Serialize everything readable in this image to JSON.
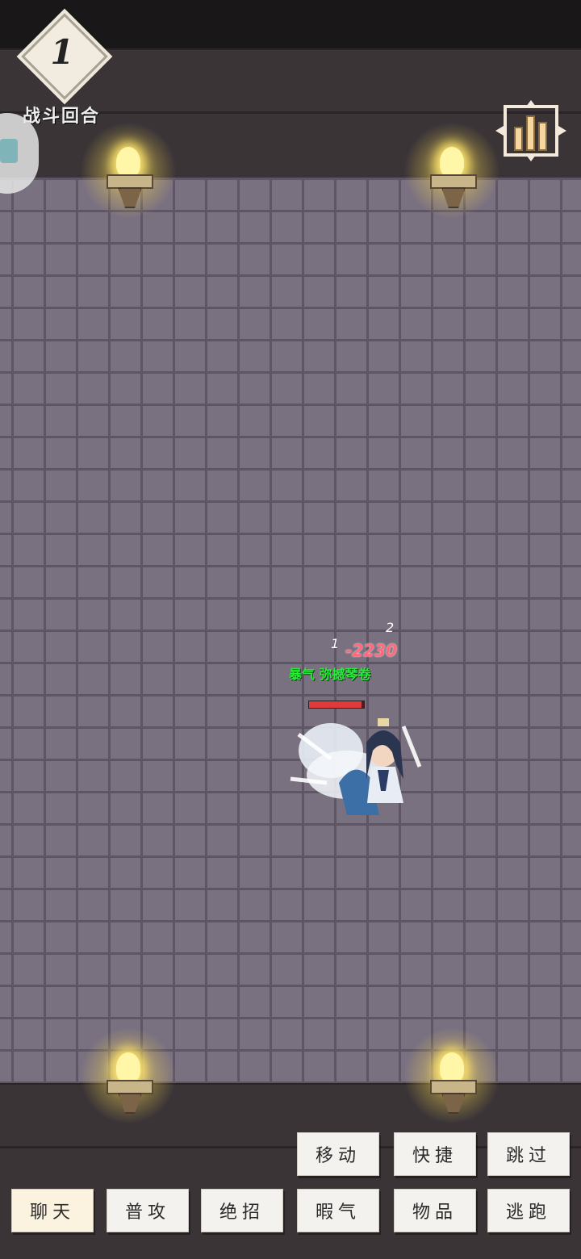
{
  "hud": {
    "round_number": "1",
    "round_label": "战斗回合"
  },
  "combat": {
    "damage_text": "-2230",
    "damage_count_1": "1",
    "damage_count_2": "2",
    "character_name": "暴气 弥撼琴卷",
    "hp_fraction": 0.95
  },
  "actions": {
    "row1": [
      {
        "label": "移动"
      },
      {
        "label": "快捷"
      },
      {
        "label": "跳过"
      }
    ],
    "row2": [
      {
        "label": "聊天"
      },
      {
        "label": "普攻"
      },
      {
        "label": "绝招"
      },
      {
        "label": "暇气"
      },
      {
        "label": "物品"
      },
      {
        "label": "逃跑"
      }
    ]
  },
  "colors": {
    "floor": "#7a7180",
    "wall": "#3a3437",
    "name_green": "#2bea3a",
    "damage_red": "#ff6a7a",
    "button_bg": "#f4f2ee"
  },
  "icons": [
    "round-diamond-icon",
    "stats-chart-icon",
    "torch-icon",
    "side-float-icon"
  ]
}
